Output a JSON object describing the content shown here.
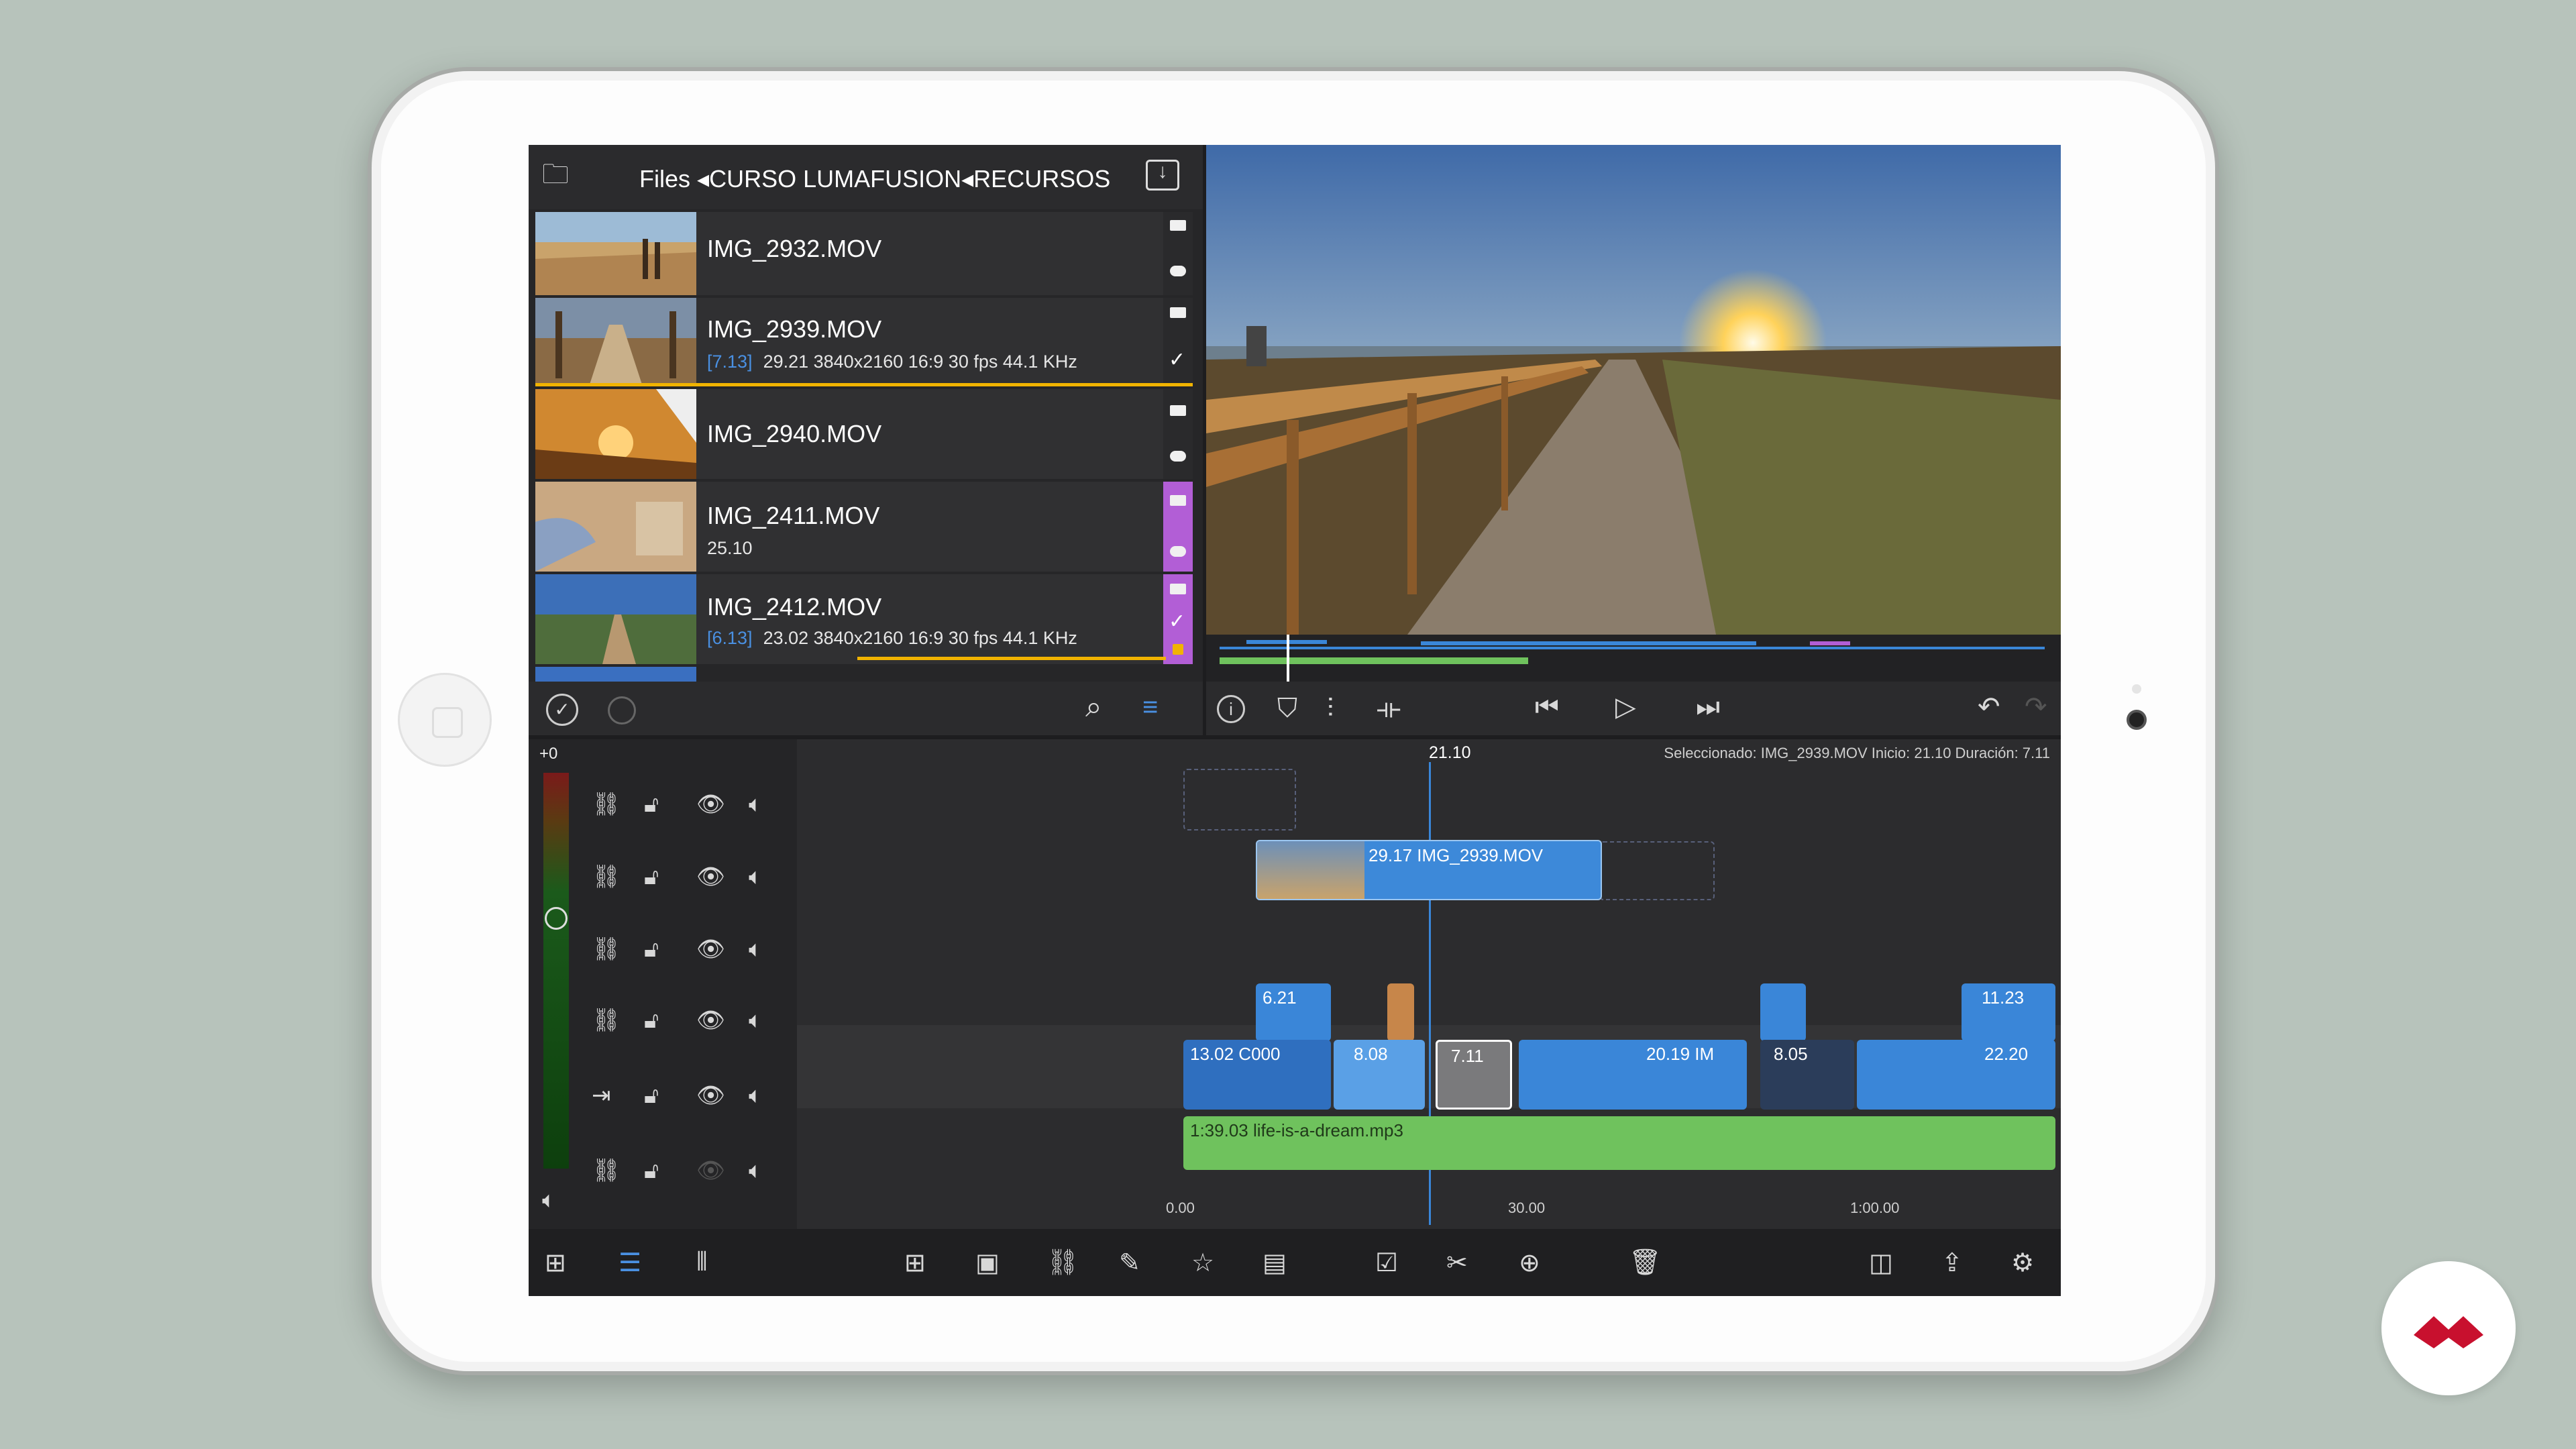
{
  "library": {
    "breadcrumb": "Files ◂CURSO LUMAFUSION◂RECURSOS",
    "items": [
      {
        "name": "IMG_2932.MOV",
        "sub_tag": "",
        "info": ""
      },
      {
        "name": "IMG_2939.MOV",
        "sub_tag": "[7.13]",
        "info": "29.21  3840x2160  16:9  30 fps  44.1 KHz"
      },
      {
        "name": "IMG_2940.MOV",
        "sub_tag": "",
        "info": ""
      },
      {
        "name": "IMG_2411.MOV",
        "sub_tag": "",
        "info": "25.10"
      },
      {
        "name": "IMG_2412.MOV",
        "sub_tag": "[6.13]",
        "info": "23.02  3840x2160  16:9  30 fps  44.1 KHz"
      }
    ]
  },
  "timeline": {
    "playhead": "21.10",
    "level": "+0",
    "selection_info": "Seleccionado: IMG_2939.MOV Inicio: 21.10 Duración: 7.11",
    "ruler": [
      "0.00",
      "30.00",
      "1:00.00"
    ],
    "clips": {
      "c1": "29.17  IMG_2939.MOV",
      "c2": "6.21",
      "c3": "11.23",
      "m1": "13.02  C000",
      "m2": "8.08",
      "m3": "7.11",
      "m4": "20.19  IM",
      "m5": "8.05",
      "m6": "22.20",
      "audio": "1:39.03  life-is-a-dream.mp3"
    }
  },
  "colors": {
    "accent_blue": "#4a90e2",
    "audio_green": "#6fc25d",
    "selection_yellow": "#f1b300",
    "purple": "#b25ed6",
    "brand_red": "#c8102e"
  }
}
